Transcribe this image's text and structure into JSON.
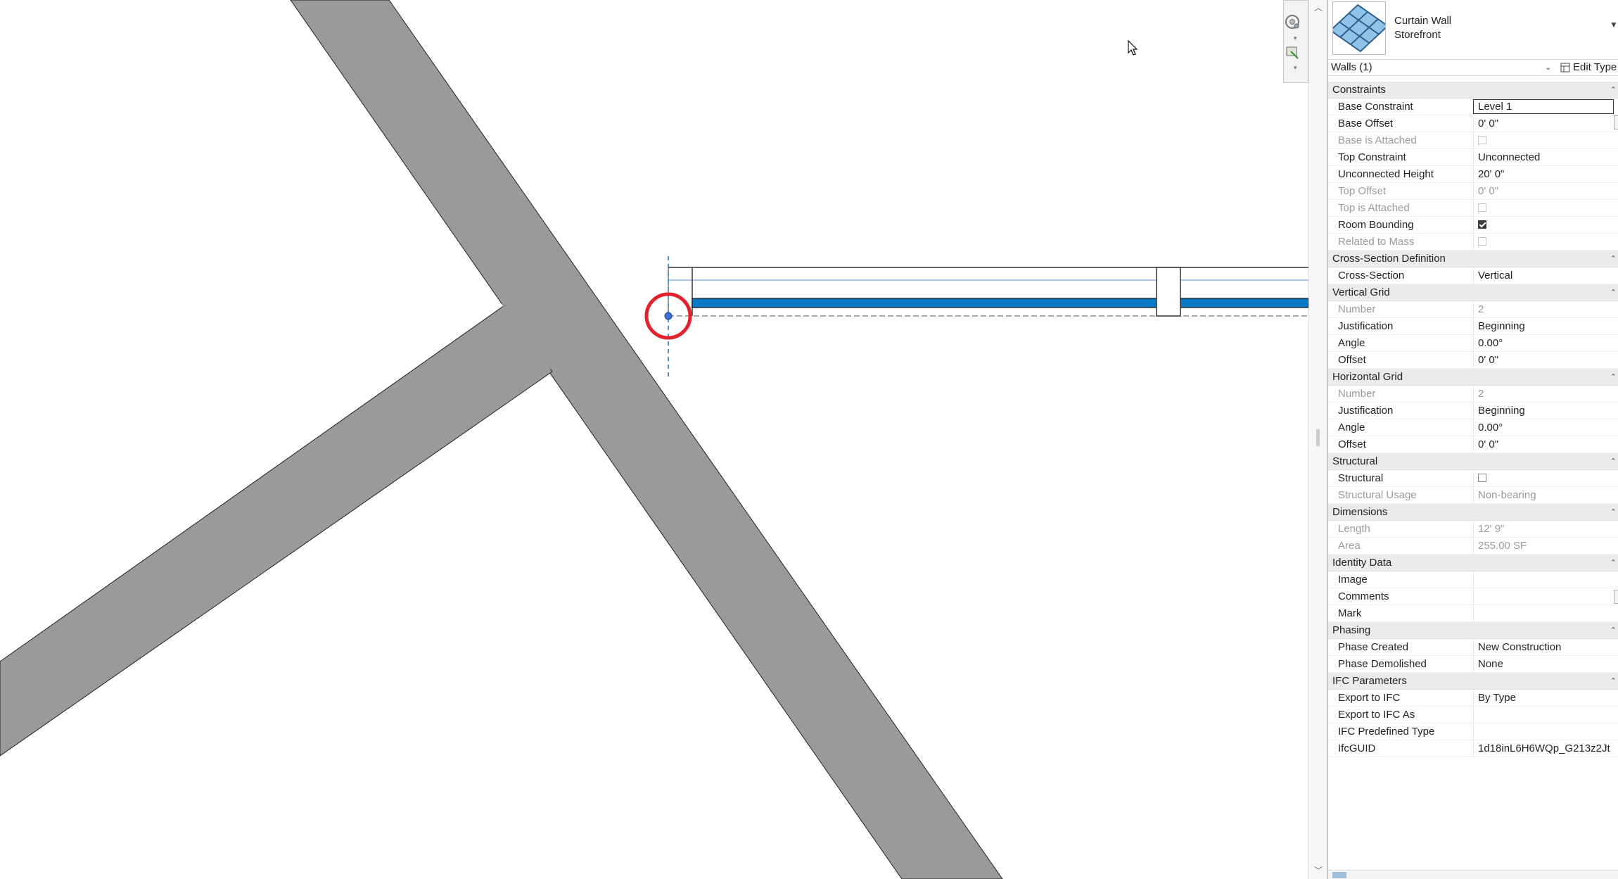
{
  "type_selector": {
    "name_line1": "Curtain Wall",
    "name_line2": "Storefront",
    "thumbnail_icon": "curtain-wall-grid-icon"
  },
  "instance": {
    "selection": "Walls (1)",
    "edit_type": "Edit Type"
  },
  "properties": [
    {
      "group": "Constraints",
      "rows": [
        {
          "label": "Base Constraint",
          "value": "Level 1",
          "editing": true
        },
        {
          "label": "Base Offset",
          "value": "0'  0\""
        },
        {
          "label": "Base is Attached",
          "checkbox": false,
          "disabled": true
        },
        {
          "label": "Top Constraint",
          "value": "Unconnected"
        },
        {
          "label": "Unconnected Height",
          "value": "20'  0\""
        },
        {
          "label": "Top Offset",
          "value": "0'  0\"",
          "disabled": true
        },
        {
          "label": "Top is Attached",
          "checkbox": false,
          "disabled": true
        },
        {
          "label": "Room Bounding",
          "checkbox": true
        },
        {
          "label": "Related to Mass",
          "checkbox": false,
          "disabled": true
        }
      ]
    },
    {
      "group": "Cross-Section Definition",
      "rows": [
        {
          "label": "Cross-Section",
          "value": "Vertical"
        }
      ]
    },
    {
      "group": "Vertical Grid",
      "rows": [
        {
          "label": "Number",
          "value": "2",
          "disabled": true
        },
        {
          "label": "Justification",
          "value": "Beginning"
        },
        {
          "label": "Angle",
          "value": "0.00°"
        },
        {
          "label": "Offset",
          "value": "0'  0\""
        }
      ]
    },
    {
      "group": "Horizontal Grid",
      "rows": [
        {
          "label": "Number",
          "value": "2",
          "disabled": true
        },
        {
          "label": "Justification",
          "value": "Beginning"
        },
        {
          "label": "Angle",
          "value": "0.00°"
        },
        {
          "label": "Offset",
          "value": "0'  0\""
        }
      ]
    },
    {
      "group": "Structural",
      "rows": [
        {
          "label": "Structural",
          "checkbox": false
        },
        {
          "label": "Structural Usage",
          "value": "Non-bearing",
          "disabled": true
        }
      ]
    },
    {
      "group": "Dimensions",
      "rows": [
        {
          "label": "Length",
          "value": "12'  9\"",
          "disabled": true
        },
        {
          "label": "Area",
          "value": "255.00 SF",
          "disabled": true
        }
      ]
    },
    {
      "group": "Identity Data",
      "rows": [
        {
          "label": "Image",
          "value": ""
        },
        {
          "label": "Comments",
          "value": ""
        },
        {
          "label": "Mark",
          "value": ""
        }
      ]
    },
    {
      "group": "Phasing",
      "rows": [
        {
          "label": "Phase Created",
          "value": "New Construction"
        },
        {
          "label": "Phase Demolished",
          "value": "None"
        }
      ]
    },
    {
      "group": "IFC Parameters",
      "rows": [
        {
          "label": "Export to IFC",
          "value": "By Type"
        },
        {
          "label": "Export to IFC As",
          "value": ""
        },
        {
          "label": "IFC Predefined Type",
          "value": ""
        },
        {
          "label": "IfcGUID",
          "value": "1d18inL6H6WQp_G213z2Jt"
        }
      ]
    }
  ],
  "colors": {
    "wall_fill": "#9a9a9a",
    "curtain_wall_highlight": "#0a79c8",
    "pick_circle": "#e2222a",
    "reference_line": "#1d6fd1"
  }
}
